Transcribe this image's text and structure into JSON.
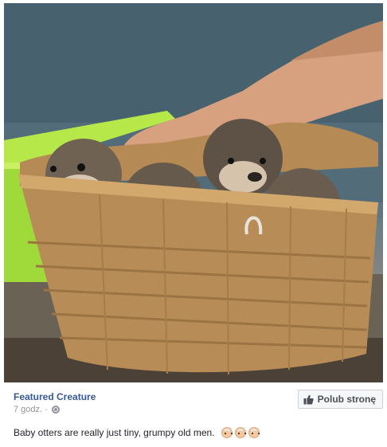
{
  "post": {
    "page_name": "Featured Creature",
    "time": "7 godz.",
    "separator": "·",
    "caption": "Baby otters are really just tiny, grumpy old men.",
    "emojis": [
      "older-man-emoji",
      "older-man-emoji",
      "older-man-emoji"
    ]
  },
  "actions": {
    "like_page_label": "Polub stronę"
  },
  "icons": {
    "like": "thumbs-up-icon",
    "audience": "globe-icon"
  },
  "colors": {
    "link_blue": "#365899",
    "muted_text": "#90949c",
    "button_border": "#ced0d4",
    "button_bg": "#f6f7f9"
  }
}
